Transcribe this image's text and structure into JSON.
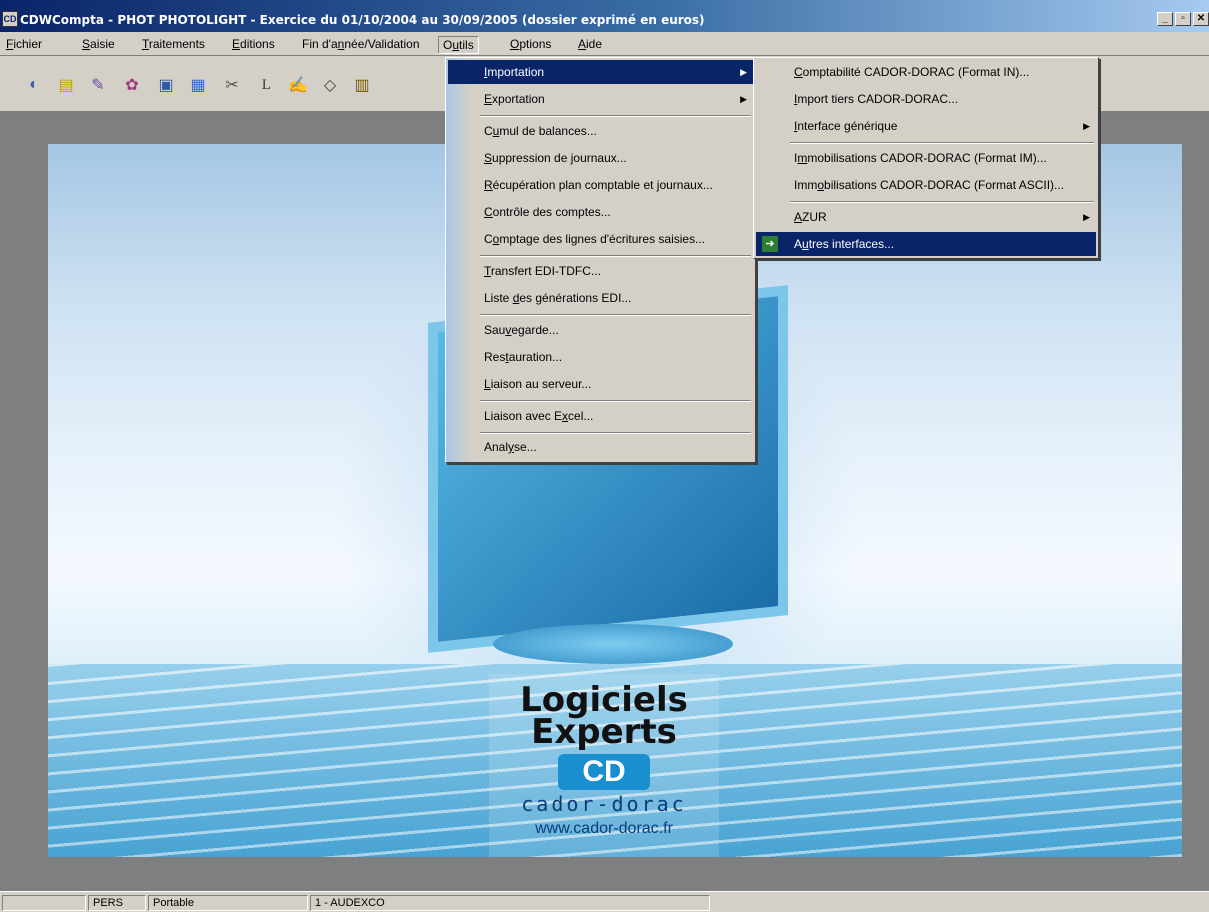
{
  "window": {
    "title": "CDWCompta - PHOT PHOTOLIGHT - Exercice du 01/10/2004 au 30/09/2005 (dossier exprimé en euros)",
    "app_icon": "CD",
    "minimize": "_",
    "restore": "▫",
    "close": "✕"
  },
  "menubar": {
    "items": [
      {
        "pre": "",
        "u": "F",
        "post": "ichier"
      },
      {
        "pre": "",
        "u": "S",
        "post": "aisie"
      },
      {
        "pre": "",
        "u": "T",
        "post": "raitements"
      },
      {
        "pre": "",
        "u": "E",
        "post": "ditions"
      },
      {
        "pre": "Fin d'a",
        "u": "n",
        "post": "née/Validation"
      },
      {
        "pre": "O",
        "u": "u",
        "post": "tils"
      },
      {
        "pre": "",
        "u": "O",
        "post": "ptions"
      },
      {
        "pre": "",
        "u": "A",
        "post": "ide"
      }
    ]
  },
  "toolbar": {
    "icons": [
      "globe-icon",
      "folder-icon",
      "pen-icon",
      "chart-icon",
      "journal-icon",
      "document-icon",
      "scissors-icon",
      "ledger-icon",
      "edit-icon",
      "eraser-icon",
      "book-icon"
    ],
    "glyphs": [
      "◐",
      "▤",
      "✎",
      "✿",
      "▣",
      "▦",
      "✂",
      "L",
      "✍",
      "◇",
      "▥"
    ]
  },
  "outils_menu": {
    "items": [
      {
        "pre": "",
        "u": "I",
        "post": "mportation",
        "submenu": true
      },
      {
        "pre": "",
        "u": "E",
        "post": "xportation",
        "submenu": true
      },
      {
        "pre": "C",
        "u": "u",
        "post": "mul de balances..."
      },
      {
        "pre": "",
        "u": "S",
        "post": "uppression de journaux..."
      },
      {
        "pre": "",
        "u": "R",
        "post": "écupération plan comptable et journaux..."
      },
      {
        "pre": "",
        "u": "C",
        "post": "ontrôle des comptes..."
      },
      {
        "pre": "C",
        "u": "o",
        "post": "mptage des lignes d'écritures saisies..."
      },
      {
        "pre": "",
        "u": "T",
        "post": "ransfert EDI-TDFC..."
      },
      {
        "pre": "Liste ",
        "u": "d",
        "post": "es générations EDI..."
      },
      {
        "pre": "Sau",
        "u": "v",
        "post": "egarde..."
      },
      {
        "pre": "Res",
        "u": "t",
        "post": "auration..."
      },
      {
        "pre": "",
        "u": "L",
        "post": "iaison au serveur..."
      },
      {
        "pre": "Liaison avec E",
        "u": "x",
        "post": "cel..."
      },
      {
        "pre": "Anal",
        "u": "y",
        "post": "se..."
      }
    ]
  },
  "import_submenu": {
    "items": [
      {
        "pre": "",
        "u": "C",
        "post": "omptabilité CADOR-DORAC (Format IN)..."
      },
      {
        "pre": "",
        "u": "I",
        "post": "mport tiers CADOR-DORAC..."
      },
      {
        "pre": "",
        "u": "I",
        "post": "nterface générique",
        "submenu": true
      },
      {
        "pre": "I",
        "u": "m",
        "post": "mobilisations CADOR-DORAC (Format IM)..."
      },
      {
        "pre": "Imm",
        "u": "o",
        "post": "bilisations CADOR-DORAC (Format ASCII)..."
      },
      {
        "pre": "",
        "u": "A",
        "post": "ZUR",
        "submenu": true
      },
      {
        "pre": "A",
        "u": "u",
        "post": "tres interfaces..."
      }
    ],
    "submenu_arrow": "▶"
  },
  "logo": {
    "line1": "Logiciels",
    "line2": "Experts",
    "mark": "CD",
    "brand": "cador-dorac",
    "url": "www.cador-dorac.fr"
  },
  "status": {
    "cells": [
      "",
      "PERS",
      "Portable",
      "1 - AUDEXCO"
    ]
  },
  "colors": {
    "highlight": "#0a246a",
    "face": "#d4d0c8"
  }
}
